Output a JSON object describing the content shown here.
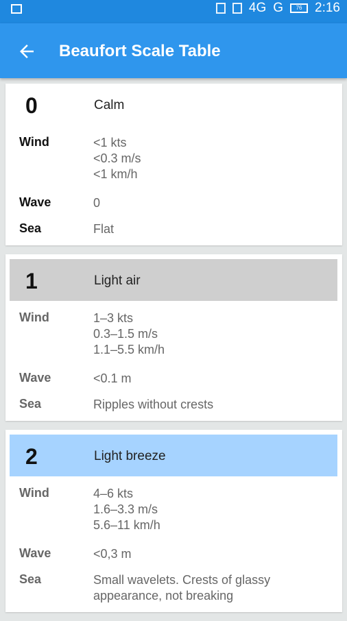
{
  "status_bar": {
    "network": "4G",
    "network2": "G",
    "battery": "76",
    "time": "2:16"
  },
  "app_bar": {
    "title": "Beaufort Scale Table",
    "back_icon": "arrow-left-icon"
  },
  "labels": {
    "wind": "Wind",
    "wave": "Wave",
    "sea": "Sea"
  },
  "colors": {
    "app_bar": "#2f96ed",
    "status_bar": "#1f88df",
    "selected_row": "#a6d3ff",
    "grey_row": "#cfcfcf"
  },
  "entries": [
    {
      "number": "0",
      "name": "Calm",
      "wind": [
        "<1 kts",
        "<0.3 m/s",
        "<1 km/h"
      ],
      "wave": "0",
      "sea": "Flat"
    },
    {
      "number": "1",
      "name": "Light air",
      "wind": [
        "1–3 kts",
        "0.3–1.5 m/s",
        "1.1–5.5 km/h"
      ],
      "wave": "<0.1 m",
      "sea": "Ripples without crests"
    },
    {
      "number": "2",
      "name": "Light breeze",
      "wind": [
        "4–6 kts",
        "1.6–3.3 m/s",
        "5.6–11 km/h"
      ],
      "wave": "<0,3 m",
      "sea": "Small wavelets. Crests of glassy appearance, not breaking"
    }
  ]
}
